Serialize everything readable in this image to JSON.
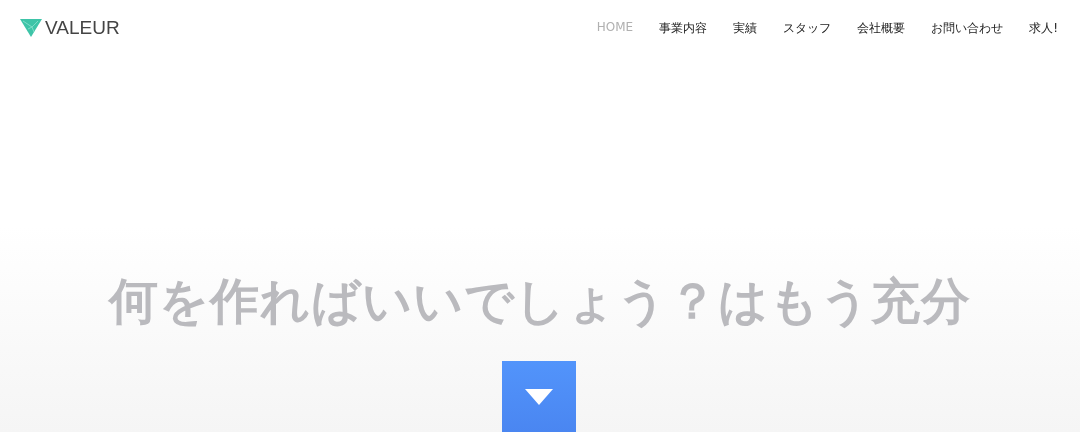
{
  "logo": {
    "text": "VALEUR"
  },
  "nav": [
    {
      "label": "HOME",
      "selected": true
    },
    {
      "label": "事業内容",
      "selected": false
    },
    {
      "label": "実績",
      "selected": false
    },
    {
      "label": "スタッフ",
      "selected": false
    },
    {
      "label": "会社概要",
      "selected": false
    },
    {
      "label": "お問い合わせ",
      "selected": false
    },
    {
      "label": "求人!",
      "selected": false
    }
  ],
  "hero": {
    "headline": "何を作ればいいでしょう？はもう充分"
  }
}
